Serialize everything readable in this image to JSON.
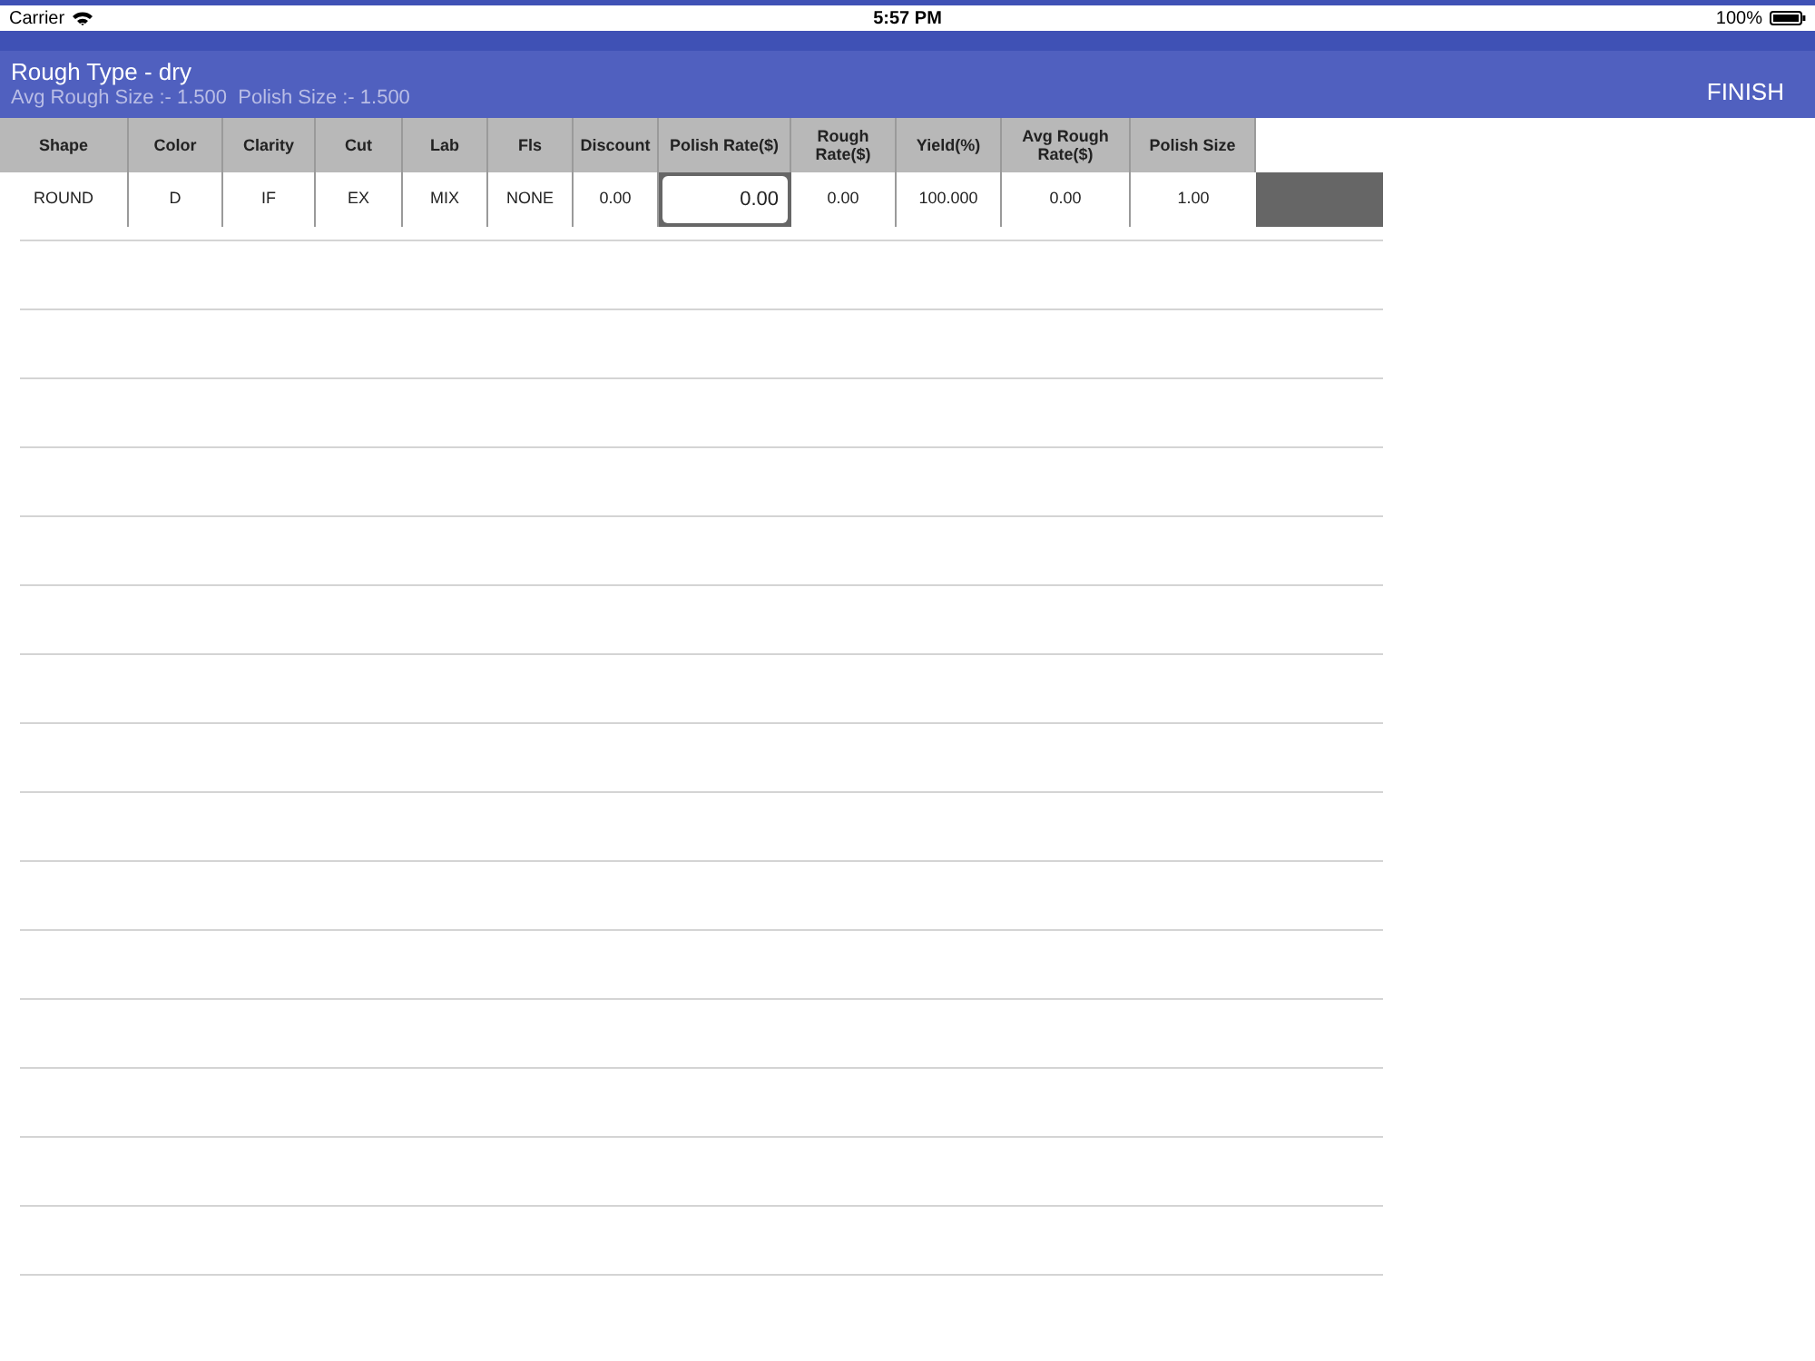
{
  "status_bar": {
    "carrier": "Carrier",
    "time": "5:57 PM",
    "battery": "100%"
  },
  "header": {
    "title": "Rough Type - dry",
    "subtitle": "Avg Rough Size :- 1.500  Polish Size :- 1.500",
    "action": "FINISH"
  },
  "table": {
    "columns": [
      {
        "label": "Shape",
        "kind": "text"
      },
      {
        "label": "Color",
        "kind": "text"
      },
      {
        "label": "Clarity",
        "kind": "text"
      },
      {
        "label": "Cut",
        "kind": "text"
      },
      {
        "label": "Lab",
        "kind": "text"
      },
      {
        "label": "Fls",
        "kind": "text"
      },
      {
        "label": "Discount",
        "kind": "text"
      },
      {
        "label": "Polish Rate($)",
        "kind": "input"
      },
      {
        "label": "Rough Rate($)",
        "kind": "text"
      },
      {
        "label": "Yield(%)",
        "kind": "text"
      },
      {
        "label": "Avg Rough Rate($)",
        "kind": "text"
      },
      {
        "label": "Polish Size",
        "kind": "text"
      }
    ],
    "rows": [
      {
        "cells": [
          "ROUND",
          "D",
          "IF",
          "EX",
          "MIX",
          "NONE",
          "0.00",
          "0.00",
          "0.00",
          "100.000",
          "0.00",
          "1.00"
        ]
      }
    ]
  }
}
